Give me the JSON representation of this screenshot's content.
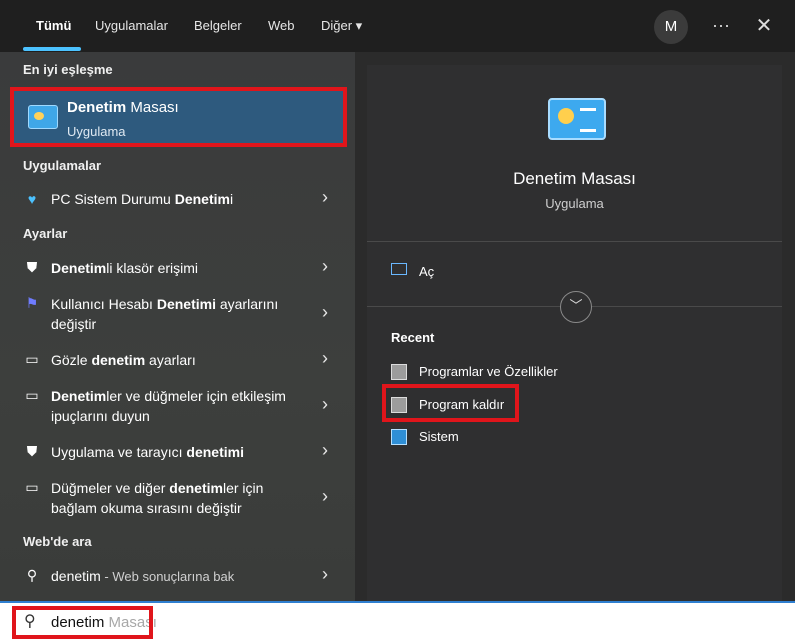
{
  "tabs": [
    {
      "label": "Tümü",
      "active": true
    },
    {
      "label": "Uygulamalar"
    },
    {
      "label": "Belgeler"
    },
    {
      "label": "Web"
    },
    {
      "label": "Diğer ▾"
    }
  ],
  "user_initial": "M",
  "more_glyph": "···",
  "close_glyph": "✕",
  "sections": {
    "best": "En iyi eşleşme",
    "apps": "Uygulamalar",
    "settings": "Ayarlar",
    "web": "Web'de ara"
  },
  "best_match": {
    "title_bold": "Denetim",
    "title_rest": " Masası",
    "subtitle": "Uygulama"
  },
  "apps": [
    {
      "pre": "PC Sistem Durumu ",
      "bold": "Denetim",
      "post": "i",
      "icon": "heart-pulse-icon"
    }
  ],
  "settings": [
    {
      "pre": "",
      "bold": "Denetim",
      "post": "li klasör erişimi",
      "icon": "shield-icon"
    },
    {
      "pre": "Kullanıcı Hesabı ",
      "bold": "Denetimi",
      "post": " ayarlarını değiştir",
      "icon": "flag-icon"
    },
    {
      "pre": "Gözle ",
      "bold": "denetim",
      "post": " ayarları",
      "icon": "monitor-icon"
    },
    {
      "pre": "",
      "bold": "Denetim",
      "post": "ler ve düğmeler için etkileşim ipuçlarını duyun",
      "icon": "monitor-speaker-icon"
    },
    {
      "pre": "Uygulama ve tarayıcı ",
      "bold": "denetimi",
      "post": "",
      "icon": "shield-icon"
    },
    {
      "pre": "Düğmeler ve diğer ",
      "bold": "denetim",
      "post": "ler için bağlam okuma sırasını değiştir",
      "icon": "monitor-speaker-icon"
    }
  ],
  "web": {
    "query": "denetim",
    "suffix": " - Web sonuçlarına bak"
  },
  "preview": {
    "title": "Denetim Masası",
    "subtitle": "Uygulama",
    "open": "Aç",
    "recent_heading": "Recent",
    "recent": [
      {
        "label": "Programlar ve Özellikler",
        "icon": "programs-icon"
      },
      {
        "label": "Program kaldır",
        "icon": "programs-icon"
      },
      {
        "label": "Sistem",
        "icon": "system-icon"
      }
    ]
  },
  "search": {
    "typed": "denetim",
    "suggestion": " Masası"
  },
  "colors": {
    "accent": "#4cc2ff",
    "highlight": "#e0151b",
    "selected": "#2e5a7e"
  }
}
